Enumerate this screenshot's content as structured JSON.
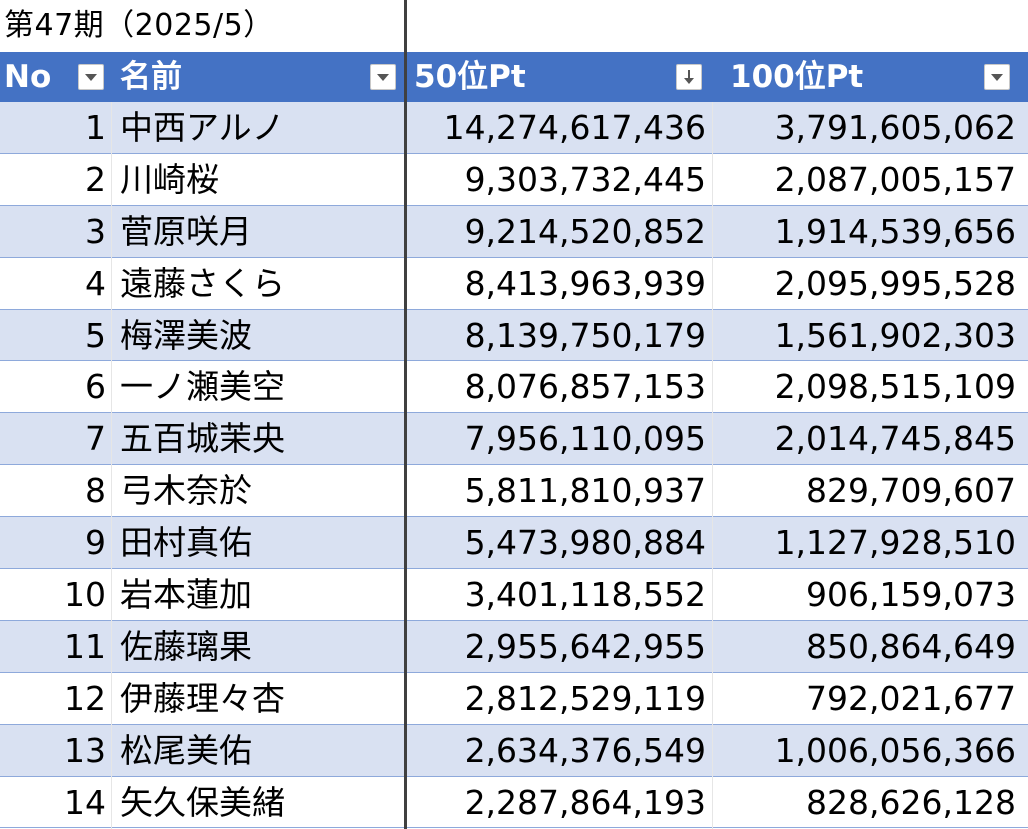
{
  "title": "第47期（2025/5）",
  "columns": {
    "no": "No",
    "name": "名前",
    "p50": "50位Pt",
    "p100": "100位Pt"
  },
  "filter_icons": {
    "no": "dropdown-icon",
    "name": "dropdown-icon",
    "p50": "sort-descending-icon",
    "p100": "dropdown-icon"
  },
  "colors": {
    "header_bg": "#4472c4",
    "band_bg": "#d9e1f2"
  },
  "rows": [
    {
      "no": "1",
      "name": "中西アルノ",
      "p50": "14,274,617,436",
      "p100": "3,791,605,062"
    },
    {
      "no": "2",
      "name": "川崎桜",
      "p50": "9,303,732,445",
      "p100": "2,087,005,157"
    },
    {
      "no": "3",
      "name": "菅原咲月",
      "p50": "9,214,520,852",
      "p100": "1,914,539,656"
    },
    {
      "no": "4",
      "name": "遠藤さくら",
      "p50": "8,413,963,939",
      "p100": "2,095,995,528"
    },
    {
      "no": "5",
      "name": "梅澤美波",
      "p50": "8,139,750,179",
      "p100": "1,561,902,303"
    },
    {
      "no": "6",
      "name": "一ノ瀬美空",
      "p50": "8,076,857,153",
      "p100": "2,098,515,109"
    },
    {
      "no": "7",
      "name": "五百城茉央",
      "p50": "7,956,110,095",
      "p100": "2,014,745,845"
    },
    {
      "no": "8",
      "name": "弓木奈於",
      "p50": "5,811,810,937",
      "p100": "829,709,607"
    },
    {
      "no": "9",
      "name": "田村真佑",
      "p50": "5,473,980,884",
      "p100": "1,127,928,510"
    },
    {
      "no": "10",
      "name": "岩本蓮加",
      "p50": "3,401,118,552",
      "p100": "906,159,073"
    },
    {
      "no": "11",
      "name": "佐藤璃果",
      "p50": "2,955,642,955",
      "p100": "850,864,649"
    },
    {
      "no": "12",
      "name": "伊藤理々杏",
      "p50": "2,812,529,119",
      "p100": "792,021,677"
    },
    {
      "no": "13",
      "name": "松尾美佑",
      "p50": "2,634,376,549",
      "p100": "1,006,056,366"
    },
    {
      "no": "14",
      "name": "矢久保美緒",
      "p50": "2,287,864,193",
      "p100": "828,626,128"
    }
  ]
}
